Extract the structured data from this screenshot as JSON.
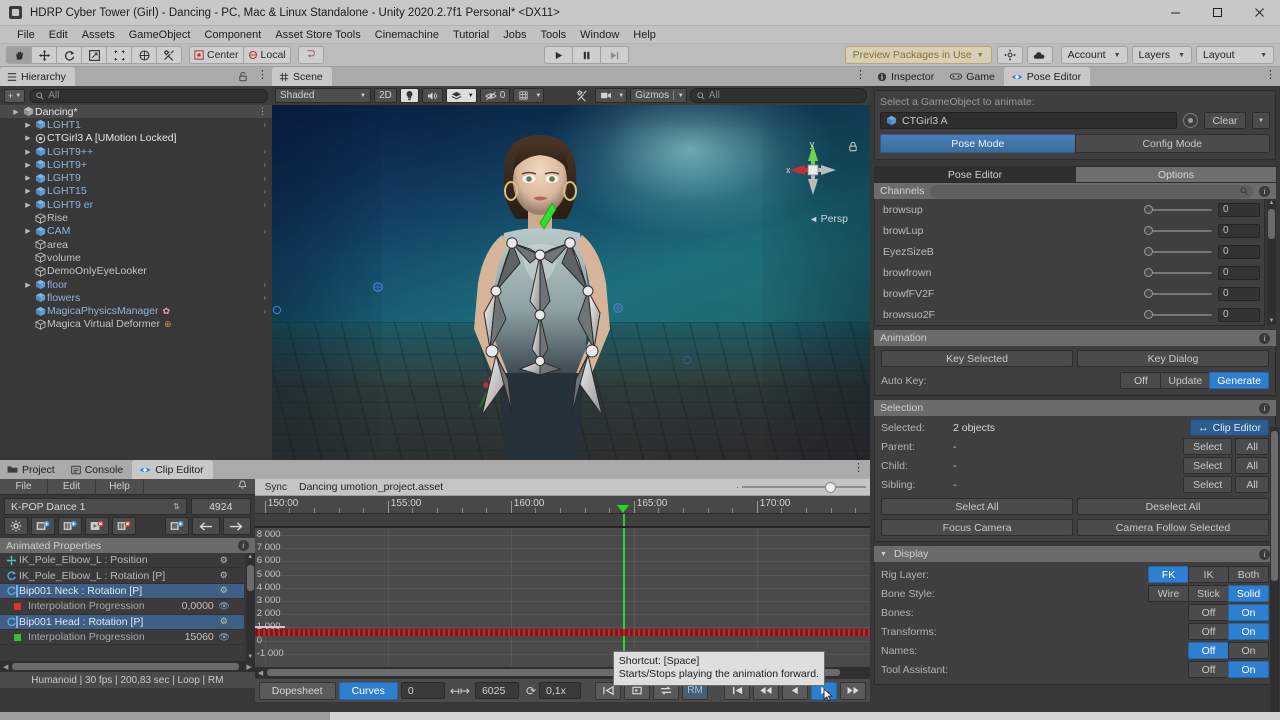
{
  "titlebar": {
    "title": "HDRP Cyber Tower (Girl) - Dancing - PC, Mac & Linux Standalone - Unity 2020.2.7f1 Personal* <DX11>"
  },
  "menubar": {
    "items": [
      "File",
      "Edit",
      "Assets",
      "GameObject",
      "Component",
      "Asset Store Tools",
      "Cinemachine",
      "Tutorial",
      "Jobs",
      "Tools",
      "Window",
      "Help"
    ]
  },
  "toolbar": {
    "tools": [
      "hand-icon",
      "move-icon",
      "rotate-icon",
      "scale-icon",
      "rect-icon",
      "transform-icon",
      "custom-icon"
    ],
    "pivot_label": "Center",
    "space_label": "Local",
    "play_label": "play-icon",
    "pause_label": "pause-icon",
    "step_label": "step-icon",
    "preview_packages": "Preview Packages in Use",
    "collab_icon": "collab-icon",
    "cloud_icon": "cloud-icon",
    "account": "Account",
    "layers": "Layers",
    "layout": "Layout"
  },
  "hierarchy": {
    "tab": "Hierarchy",
    "add_label": "+",
    "search_placeholder": "All",
    "items": [
      {
        "name": "Dancing*",
        "indent": 0,
        "arrow": true,
        "icon": "scene-icon",
        "color": "white",
        "chev": false,
        "dots": true,
        "root": true
      },
      {
        "name": "LGHT1",
        "indent": 1,
        "arrow": true,
        "icon": "prefab-icon",
        "color": "blue",
        "chev": true
      },
      {
        "name": "CTGirl3 A  [UMotion Locked]",
        "indent": 1,
        "arrow": true,
        "icon": "avatar-icon",
        "color": "white",
        "chev": false
      },
      {
        "name": "LGHT9++",
        "indent": 1,
        "arrow": true,
        "icon": "prefab-icon",
        "color": "blue",
        "chev": true
      },
      {
        "name": "LGHT9+",
        "indent": 1,
        "arrow": true,
        "icon": "prefab-icon",
        "color": "blue",
        "chev": true
      },
      {
        "name": "LGHT9",
        "indent": 1,
        "arrow": true,
        "icon": "prefab-icon",
        "color": "blue",
        "chev": true
      },
      {
        "name": "LGHT15",
        "indent": 1,
        "arrow": true,
        "icon": "prefab-icon",
        "color": "blue",
        "chev": true
      },
      {
        "name": "LGHT9 er",
        "indent": 1,
        "arrow": true,
        "icon": "prefab-icon",
        "color": "blue",
        "chev": true
      },
      {
        "name": "Rise",
        "indent": 1,
        "arrow": false,
        "icon": "gameobject-icon",
        "color": "grayn",
        "chev": false
      },
      {
        "name": "CAM",
        "indent": 1,
        "arrow": true,
        "icon": "prefab-icon",
        "color": "blue",
        "chev": true
      },
      {
        "name": "area",
        "indent": 1,
        "arrow": false,
        "icon": "gameobject-icon",
        "color": "grayn",
        "chev": false
      },
      {
        "name": "volume",
        "indent": 1,
        "arrow": false,
        "icon": "gameobject-icon",
        "color": "grayn",
        "chev": false
      },
      {
        "name": "DemoOnlyEyeLooker",
        "indent": 1,
        "arrow": false,
        "icon": "gameobject-icon",
        "color": "grayn",
        "chev": false
      },
      {
        "name": "floor",
        "indent": 1,
        "arrow": true,
        "icon": "prefab-icon",
        "color": "blue",
        "chev": true
      },
      {
        "name": "flowers",
        "indent": 1,
        "arrow": false,
        "icon": "prefab-icon",
        "color": "blue",
        "chev": true
      },
      {
        "name": "MagicaPhysicsManager",
        "indent": 1,
        "arrow": false,
        "icon": "prefab-icon",
        "color": "blue",
        "chev": true,
        "badge": "star"
      },
      {
        "name": "Magica Virtual Deformer",
        "indent": 1,
        "arrow": false,
        "icon": "gameobject-icon",
        "color": "grayn",
        "chev": false,
        "badge": "globe"
      }
    ]
  },
  "scene": {
    "tab": "Scene",
    "shading": "Shaded",
    "mode_2d": "2D",
    "light_icon": "lightbulb-icon",
    "audio_icon": "audio-icon",
    "fx_icon": "effects-icon",
    "hidden_count": "0",
    "grid_icon": "grid-icon",
    "tool_icon": "scene-tools-icon",
    "camera_icon": "camera-icon",
    "gizmos": "Gizmos",
    "search_placeholder": "All",
    "persp_label": "Persp",
    "axis_x": "x",
    "axis_y": "y"
  },
  "inspector": {
    "tabs": [
      {
        "label": "Inspector",
        "icon": "info-icon",
        "active": false
      },
      {
        "label": "Game",
        "icon": "gamepad-icon",
        "active": false
      },
      {
        "label": "Pose Editor",
        "icon": "eye-icon",
        "active": true
      }
    ],
    "select_hint": "Select a GameObject to animate:",
    "object_value": "CTGirl3 A",
    "clear_label": "Clear",
    "modes": [
      {
        "label": "Pose Mode",
        "active": true
      },
      {
        "label": "Config Mode",
        "active": false
      }
    ],
    "subtabs": [
      {
        "label": "Pose Editor",
        "active": true
      },
      {
        "label": "Options",
        "active": false
      }
    ],
    "channels": {
      "header": "Channels",
      "rows": [
        {
          "name": "browsup",
          "value": "0"
        },
        {
          "name": "browLup",
          "value": "0"
        },
        {
          "name": "EyezSizeB",
          "value": "0"
        },
        {
          "name": "browfrown",
          "value": "0"
        },
        {
          "name": "browfFV2F",
          "value": "0"
        },
        {
          "name": "browsuo2F",
          "value": "0"
        }
      ]
    },
    "animation": {
      "header": "Animation",
      "key_selected": "Key Selected",
      "key_dialog": "Key Dialog",
      "auto_key_label": "Auto Key:",
      "auto_key_options": [
        {
          "label": "Off",
          "active": false
        },
        {
          "label": "Update",
          "active": false
        },
        {
          "label": "Generate",
          "active": true
        }
      ]
    },
    "selection": {
      "header": "Selection",
      "selected_label": "Selected:",
      "selected_value": "2 objects",
      "clip_editor_btn": "Clip Editor",
      "parent_label": "Parent:",
      "parent_value": "-",
      "child_label": "Child:",
      "child_value": "-",
      "sibling_label": "Sibling:",
      "sibling_value": "-",
      "select_label": "Select",
      "all_label": "All",
      "select_all": "Select All",
      "deselect_all": "Deselect All",
      "focus_camera": "Focus Camera",
      "camera_follow": "Camera Follow Selected"
    },
    "display": {
      "header": "Display",
      "rows": [
        {
          "label": "Rig Layer:",
          "options": [
            {
              "label": "FK",
              "active": true
            },
            {
              "label": "IK",
              "active": false
            },
            {
              "label": "Both",
              "active": false
            }
          ]
        },
        {
          "label": "Bone Style:",
          "options": [
            {
              "label": "Wire",
              "active": false
            },
            {
              "label": "Stick",
              "active": false
            },
            {
              "label": "Solid",
              "active": true
            }
          ]
        },
        {
          "label": "Bones:",
          "options": [
            {
              "label": "Off",
              "active": false
            },
            {
              "label": "On",
              "active": true
            }
          ]
        },
        {
          "label": "Transforms:",
          "options": [
            {
              "label": "Off",
              "active": false
            },
            {
              "label": "On",
              "active": true
            }
          ]
        },
        {
          "label": "Names:",
          "options": [
            {
              "label": "Off",
              "active": true
            },
            {
              "label": "On",
              "active": false
            }
          ]
        },
        {
          "label": "Tool Assistant:",
          "options": [
            {
              "label": "Off",
              "active": false
            },
            {
              "label": "On",
              "active": true
            }
          ]
        }
      ]
    }
  },
  "bottom": {
    "tabs": [
      {
        "label": "Project",
        "icon": "folder-icon",
        "active": false
      },
      {
        "label": "Console",
        "icon": "console-icon",
        "active": false
      },
      {
        "label": "Clip Editor",
        "icon": "eye-icon",
        "active": true
      }
    ],
    "menu": [
      "File",
      "Edit",
      "Help"
    ],
    "clip_name": "K-POP Dance 1",
    "frame_count": "4924",
    "toolbar_icons": [
      "settings-icon",
      "add-clip-icon",
      "duplicate-clip-icon",
      "add-keyframe-icon",
      "remove-keyframe-icon",
      "paste-clip-icon",
      "prev-arrow-icon",
      "next-arrow-icon"
    ],
    "animated_properties_header": "Animated Properties",
    "properties": [
      {
        "name": "IK_Pole_Elbow_L : Position",
        "icon": "position-icon",
        "selected": false
      },
      {
        "name": "IK_Pole_Elbow_L : Rotation [P]",
        "icon": "rotation-icon",
        "selected": false
      },
      {
        "name": "Bip001 Neck : Rotation [P]",
        "icon": "rotation-icon",
        "selected": true,
        "sub": {
          "name": "Interpolation Progression",
          "value": "0,0000",
          "color": "#e03030"
        }
      },
      {
        "name": "Bip001 Head : Rotation [P]",
        "icon": "rotation-icon",
        "selected": true,
        "sub": {
          "name": "Interpolation Progression",
          "value": "15060",
          "color": "#35c035"
        }
      }
    ],
    "status": "Humanoid | 30 fps | 200,83 sec | Loop | RM",
    "sync_label": "Sync",
    "asset_name": "Dancing umotion_project.asset",
    "ruler_labels": [
      "150:00",
      "155:00",
      "160:00",
      "165:00",
      "170:00"
    ],
    "y_labels": [
      "8 000",
      "7 000",
      "6 000",
      "5 000",
      "4 000",
      "3 000",
      "2 000",
      "1 000",
      "0",
      "-1 000"
    ],
    "view_modes": [
      {
        "label": "Dopesheet",
        "active": false
      },
      {
        "label": "Curves",
        "active": true
      }
    ],
    "range_start": "0",
    "range_end": "6025",
    "speed": "0,1x",
    "rm_label": "RM",
    "transport": [
      "start-icon",
      "loop-icon",
      "repeat-icon",
      "rm-toggle",
      "first-frame-icon",
      "rewind-icon",
      "play-back-icon",
      "play-forward-icon",
      "fast-forward-icon"
    ],
    "tooltip_line1": "Shortcut: [Space]",
    "tooltip_line2": "Starts/Stops playing the animation forward."
  },
  "colors": {
    "accent_blue": "#2f7fd1",
    "playhead_green": "#25d825",
    "panel_bg": "#383838",
    "warn_yellow": "#8a7322"
  }
}
